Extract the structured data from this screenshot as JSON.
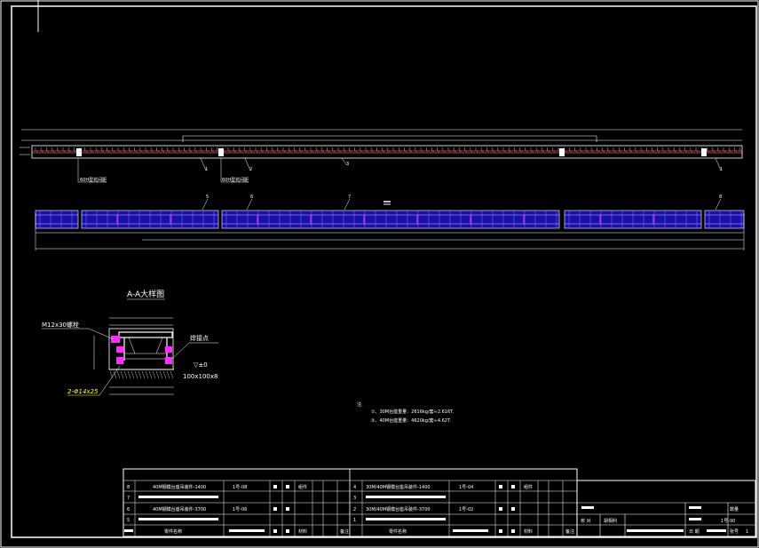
{
  "detail": {
    "title": "A-A大样图",
    "bolt_label": "M12x30螺栓",
    "weld_label": "焊接点",
    "level_label": "▽±0",
    "angle_label": "100x100x8",
    "hole_label": "2-Φ14x25"
  },
  "elevation": {
    "callouts": [
      "1",
      "2",
      "3",
      "1"
    ],
    "note_left": "60H型花间距",
    "note_mid": "60H型花间距"
  },
  "plan": {
    "callouts": [
      "5",
      "6",
      "7",
      "8"
    ]
  },
  "notes": {
    "heading": "注:",
    "lines": [
      "①、30M台座重量：2616kg/套≈2.616T.",
      "②、40M台座重量：4620kg/套≈4.62T."
    ]
  },
  "bom": {
    "rows": [
      {
        "no_l": "8",
        "name_l": "40M钢模台座吊装件-1400",
        "dwg_l": "1号-08",
        "mat_l": "组件",
        "no_r": "4",
        "name_r": "30M/40M钢模台座吊装件-1400",
        "dwg_r": "1号-04",
        "mat_r": "组件"
      },
      {
        "no_l": "7",
        "name_l": "",
        "dwg_l": "",
        "mat_l": "",
        "no_r": "3",
        "name_r": "",
        "dwg_r": "",
        "mat_r": ""
      },
      {
        "no_l": "6",
        "name_l": "40M钢模台座吊装件-3700",
        "dwg_l": "1号-06",
        "mat_l": "",
        "no_r": "2",
        "name_r": "30M/40M钢模台座吊装件-3700",
        "dwg_r": "1号-02",
        "mat_r": ""
      },
      {
        "no_l": "5",
        "name_l": "",
        "dwg_l": "",
        "mat_l": "",
        "no_r": "1",
        "name_r": "",
        "dwg_r": "",
        "mat_r": ""
      }
    ],
    "footer_l": {
      "name": "零件名称",
      "material": "材料",
      "remark": "备注"
    },
    "footer_r": {
      "name": "零件名称",
      "material": "材料",
      "remark": "备注"
    }
  },
  "titleblock": {
    "quantity_label": "数量",
    "check_label": "校 对",
    "checker": "胡相利",
    "drawing_no": "1号-00",
    "date_label": "日 期",
    "sheet_label": "张号",
    "sheet_no": "1"
  }
}
